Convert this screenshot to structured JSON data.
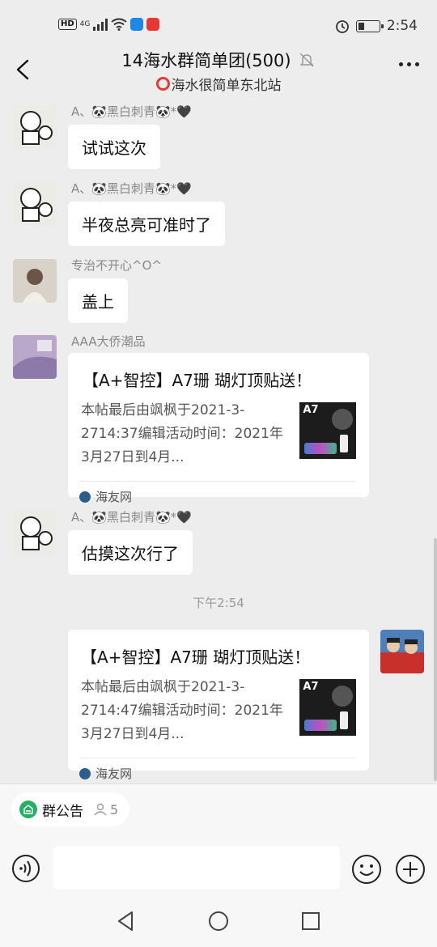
{
  "status_bar": {
    "hd_label": "HD",
    "network_label": "4G",
    "time": "2:54",
    "icons": [
      "signal-icon",
      "wifi-icon",
      "alarm-icon",
      "battery-icon"
    ],
    "battery_level": 0.3
  },
  "header": {
    "title": "14海水群简单团(500)",
    "subtitle": "海水很简单东北站",
    "icons": [
      "back-icon",
      "mute-icon",
      "more-icon"
    ]
  },
  "messages": [
    {
      "sender": "A、🐼黑白刺青🐼*🖤",
      "text": "试试这次"
    },
    {
      "sender": "A、🐼黑白刺青🐼*🖤",
      "text": "半夜总亮可准时了"
    },
    {
      "sender": "专治不开心^O^",
      "text": "盖上"
    },
    {
      "sender": "AAA大侨潮品",
      "card": {
        "title": "【A+智控】A7珊 瑚灯顶贴送！",
        "body": "本帖最后由飒枫于2021-3-2714:37编辑活动时间：2021年3月27日到4月...",
        "thumb_label": "A7",
        "source": "海友网"
      }
    },
    {
      "sender": "A、🐼黑白刺青🐼*🖤",
      "text": "估摸这次行了"
    }
  ],
  "timestamp": "下午2:54",
  "own_message": {
    "card": {
      "title": "【A+智控】A7珊 瑚灯顶贴送！",
      "body": "本帖最后由飒枫于2021-3-2714:47编辑活动时间：2021年3月27日到4月...",
      "thumb_label": "A7",
      "source": "海友网"
    }
  },
  "input": {
    "notice_label": "群公告",
    "notice_count": "5",
    "icons": [
      "voice-icon",
      "emoji-icon",
      "plus-icon"
    ]
  },
  "colors": {
    "background": "#ededed",
    "bubble": "#ffffff",
    "notice_green": "#2aae67",
    "live_red": "#e53935"
  }
}
